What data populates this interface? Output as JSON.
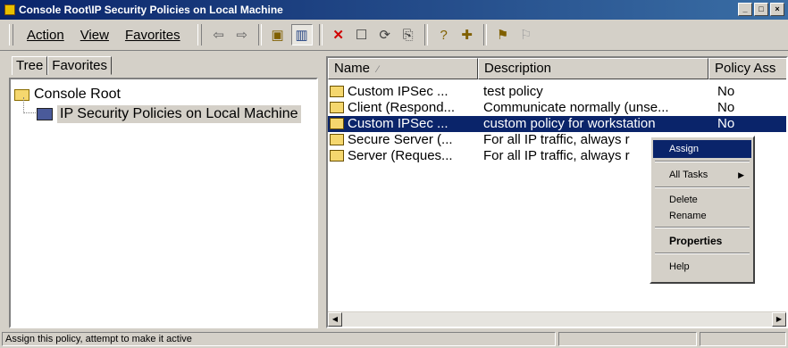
{
  "window": {
    "title": "Console Root\\IP Security Policies on Local Machine"
  },
  "menu": {
    "action": "Action",
    "view": "View",
    "favorites": "Favorites"
  },
  "tabs": {
    "tree": "Tree",
    "favorites": "Favorites"
  },
  "tree": {
    "root": "Console Root",
    "child": "IP Security Policies on Local Machine"
  },
  "list": {
    "columns": {
      "name": "Name",
      "description": "Description",
      "assigned": "Policy Ass"
    },
    "rows": [
      {
        "name": "Custom IPSec ...",
        "description": "test policy",
        "assigned": "No"
      },
      {
        "name": "Client (Respond...",
        "description": "Communicate normally (unse...",
        "assigned": "No"
      },
      {
        "name": "Custom IPSec ...",
        "description": "custom policy for workstation",
        "assigned": "No"
      },
      {
        "name": "Secure Server (...",
        "description": "For all IP traffic, always r",
        "assigned": ""
      },
      {
        "name": "Server (Reques...",
        "description": "For all IP traffic, always r",
        "assigned": ""
      }
    ]
  },
  "context_menu": {
    "assign": "Assign",
    "all_tasks": "All Tasks",
    "delete": "Delete",
    "rename": "Rename",
    "properties": "Properties",
    "help": "Help"
  },
  "status": {
    "text": "Assign this policy, attempt to make it active"
  }
}
